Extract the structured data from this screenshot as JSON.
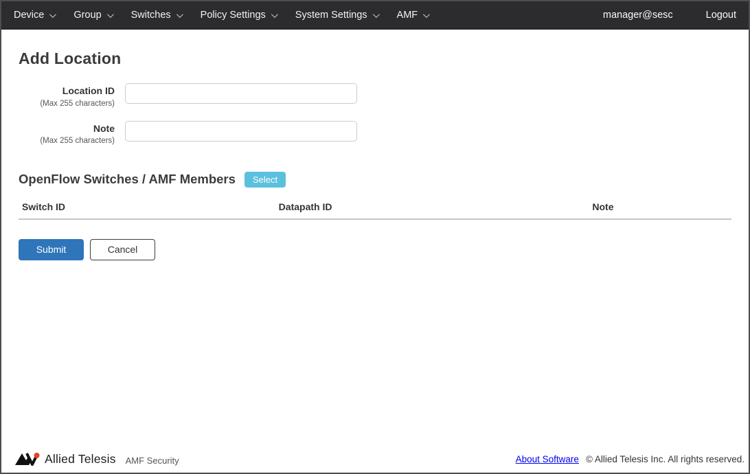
{
  "navbar": {
    "items": [
      {
        "label": "Device"
      },
      {
        "label": "Group"
      },
      {
        "label": "Switches"
      },
      {
        "label": "Policy Settings"
      },
      {
        "label": "System Settings"
      },
      {
        "label": "AMF"
      }
    ],
    "user": "manager@sesc",
    "logout_label": "Logout"
  },
  "page": {
    "title": "Add Location"
  },
  "form": {
    "fields": [
      {
        "label": "Location ID",
        "hint": "(Max 255 characters)",
        "value": ""
      },
      {
        "label": "Note",
        "hint": "(Max 255 characters)",
        "value": ""
      }
    ]
  },
  "members_section": {
    "title": "OpenFlow Switches / AMF Members",
    "select_button_label": "Select",
    "table": {
      "columns": [
        "Switch ID",
        "Datapath ID",
        "Note"
      ],
      "rows": []
    }
  },
  "actions": {
    "submit_label": "Submit",
    "cancel_label": "Cancel"
  },
  "footer": {
    "brand": "Allied Telesis",
    "product": "AMF Security",
    "about_link": "About Software",
    "copyright": "© Allied Telesis Inc. All rights reserved."
  },
  "colors": {
    "navbar_bg": "#2c2c2f",
    "select_button": "#5bc0de",
    "submit_button": "#2e75b9",
    "link": "#0000ee",
    "brand_red": "#e8402d"
  }
}
